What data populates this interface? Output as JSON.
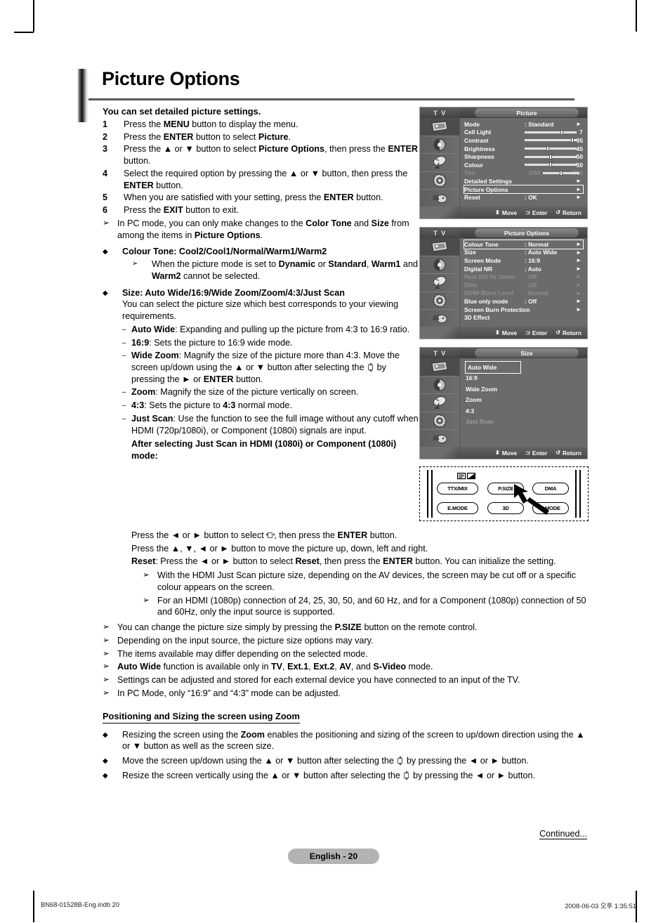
{
  "page": {
    "title": "Picture Options",
    "lead": "You can set detailed picture settings.",
    "language_badge": "English - 20",
    "continued": "Continued...",
    "footer_left": "BN68-01528B-Eng.indb   20",
    "footer_right": "2008-06-03   오후 1:35:51"
  },
  "steps": [
    {
      "num": "1",
      "html": "Press the <b>MENU</b> button to display the menu."
    },
    {
      "num": "2",
      "html": "Press the <b>ENTER</b> button to select <b>Picture</b>."
    },
    {
      "num": "3",
      "html": "Press the ▲ or ▼ button to select <b>Picture Options</b>, then press the <b>ENTER</b> button."
    },
    {
      "num": "4",
      "html": "Select the required option by pressing the ▲ or ▼ button, then press the <b>ENTER</b> button."
    },
    {
      "num": "5",
      "html": "When you are satisfied with your setting, press the <b>ENTER</b> button."
    },
    {
      "num": "6",
      "html": "Press the <b>EXIT</b> button to exit."
    }
  ],
  "notes_top": [
    "In PC mode, you can only make changes to the <b>Color Tone</b> and <b>Size</b> from among the items in <b>Picture Options</b>."
  ],
  "colour_tone": {
    "heading": "Colour Tone: Cool2/Cool1/Normal/Warm1/Warm2",
    "note": "When the picture mode is set to <b>Dynamic</b> or <b>Standard</b>, <b>Warm1</b> and <b>Warm2</b> cannot be selected."
  },
  "size_section": {
    "heading": "Size: Auto Wide/16:9/Wide Zoom/Zoom/4:3/Just Scan",
    "intro": "You can select the picture size which best corresponds to your viewing requirements.",
    "items": [
      {
        "html": "<b>Auto Wide</b>: Expanding and pulling up the picture from 4:3 to 16:9 ratio."
      },
      {
        "html": "<b>16:9</b>: Sets the picture to 16:9 wide mode."
      },
      {
        "html": "<b>Wide Zoom</b>: Magnify the size of the picture more than 4:3. Move the screen up/down using the ▲ or ▼ button after selecting the @ZICON@ by pressing the ► or <b>ENTER</b> button."
      },
      {
        "html": "<b>Zoom</b>: Magnify the size of the picture vertically on screen."
      },
      {
        "html": "<b>4:3</b>: Sets the picture to <b>4:3</b> normal mode."
      },
      {
        "html": "<b>Just Scan</b>: Use the function to see the full image without any cutoff when HDMI (720p/1080i), or Component (1080i) signals are input."
      }
    ],
    "after_heading": "After selecting Just Scan in HDMI (1080i) or Component (1080i) mode",
    "after_lines": [
      "Press the ◄ or ► button to select @ZICONLR@, then press the <b>ENTER</b> button.",
      "Press the ▲, ▼, ◄ or ► button to move the picture up, down, left and right.",
      "<b>Reset</b>: Press the ◄ or ► button to select <b>Reset</b>, then press the <b>ENTER</b> button. You can initialize the setting."
    ],
    "after_notes": [
      "With the HDMI Just Scan picture size, depending on the AV devices, the screen may be cut off or a specific colour appears on the screen.",
      "For an HDMI (1080p) connection of 24, 25, 30, 50, and 60 Hz, and for a Component (1080p) connection of 50 and 60Hz, only the input source is supported."
    ]
  },
  "general_notes": [
    "You can change the picture size simply by pressing the <b>P.SIZE</b> button on the remote control.",
    "Depending on the input source, the picture size options may vary.",
    "The items available may differ depending on the selected mode.",
    "<b>Auto Wide</b> function is available only in <b>TV</b>, <b>Ext.1</b>, <b>Ext.2</b>, <b>AV</b>, and <b>S-Video</b> mode.",
    "Settings can be adjusted and stored for each external device you have connected to an input of the TV.",
    "In PC Mode, only “16:9” and “4:3” mode can be adjusted."
  ],
  "zoom_section": {
    "heading": "Positioning and Sizing the screen using Zoom",
    "bullets": [
      "Resizing the screen using the <b>Zoom</b> enables the positioning and sizing of the screen to up/down direction using the ▲ or ▼ button as well as the screen size.",
      "Move the screen up/down using the ▲ or ▼ button after selecting the @ZICON@ by pressing the ◄ or ► button.",
      "Resize the screen vertically using the ▲ or ▼ button after selecting the @ZICON2@ by pressing the ◄ or ► button."
    ]
  },
  "osd": {
    "tv_label": "T V",
    "footer_keys": [
      {
        "icon": "updown-arrows-icon",
        "label": "Move"
      },
      {
        "icon": "enter-icon",
        "label": "Enter"
      },
      {
        "icon": "return-icon",
        "label": "Return"
      }
    ],
    "rail_icons": [
      "picture-icon",
      "sound-icon",
      "channel-icon",
      "setup-icon",
      "input-icon"
    ],
    "menus": [
      {
        "name": "picture-menu",
        "title": "Picture",
        "rows": [
          {
            "label": "Mode",
            "value": ": Standard",
            "arrow": "►",
            "type": "value"
          },
          {
            "label": "Cell Light",
            "type": "slider",
            "number": "7",
            "pos": 74
          },
          {
            "label": "Contrast",
            "type": "slider",
            "number": "95",
            "pos": 95
          },
          {
            "label": "Brightness",
            "type": "slider",
            "number": "45",
            "pos": 45
          },
          {
            "label": "Sharpness",
            "type": "slider",
            "number": "50",
            "pos": 50
          },
          {
            "label": "Colour",
            "type": "slider",
            "number": "50",
            "pos": 50
          },
          {
            "label": "Tint",
            "type": "tint",
            "left": "G50",
            "right": "R50",
            "pos": 50,
            "dim": true
          },
          {
            "label": "Detailed Settings",
            "arrow": "►",
            "type": "plain"
          },
          {
            "label": "Picture Options",
            "arrow": "►",
            "type": "plain",
            "selected": true
          },
          {
            "label": "Reset",
            "value": ": OK",
            "arrow": "►",
            "type": "value"
          }
        ]
      },
      {
        "name": "picture-options-menu",
        "title": "Picture Options",
        "rows": [
          {
            "label": "Colour Tone",
            "value": ": Normal",
            "arrow": "►",
            "type": "value",
            "selected": true
          },
          {
            "label": "Size",
            "value": ": Auto Wide",
            "arrow": "►",
            "type": "value"
          },
          {
            "label": "Screen Mode",
            "value": ": 16:9",
            "arrow": "►",
            "type": "value"
          },
          {
            "label": "Digital NR",
            "value": ": Auto",
            "arrow": "►",
            "type": "value"
          },
          {
            "label": "Real 100 Hz Demo",
            "value": ": Off",
            "arrow": "►",
            "type": "value",
            "dim": true
          },
          {
            "label": "DNIe",
            "value": ": Off",
            "arrow": "►",
            "type": "value",
            "dim": true
          },
          {
            "label": "HDMI Black Level",
            "value": ": Normal",
            "arrow": "►",
            "type": "value",
            "dim": true
          },
          {
            "label": "Blue only mode",
            "value": ": Off",
            "arrow": "►",
            "type": "value"
          },
          {
            "label": "Screen Burn Protection",
            "arrow": "►",
            "type": "plain"
          },
          {
            "label": "3D Effect",
            "type": "plain"
          }
        ]
      },
      {
        "name": "size-menu",
        "title": "Size",
        "options": [
          {
            "label": "Auto Wide",
            "selected": true
          },
          {
            "label": "16:9"
          },
          {
            "label": "Wide Zoom"
          },
          {
            "label": "Zoom"
          },
          {
            "label": "4:3"
          },
          {
            "label": "Just Scan",
            "dim": true
          }
        ]
      }
    ]
  },
  "remote": {
    "buttons": [
      {
        "label": "TTX/MIX",
        "name": "ttx-mix-button"
      },
      {
        "label": "P.SIZE",
        "name": "p-size-button"
      },
      {
        "label": "DMA",
        "name": "dma-button"
      },
      {
        "label": "E.MODE",
        "name": "e-mode-button"
      },
      {
        "label": "3D",
        "name": "3d-button"
      },
      {
        "label": "P.MODE",
        "name": "p-mode-button"
      }
    ]
  }
}
